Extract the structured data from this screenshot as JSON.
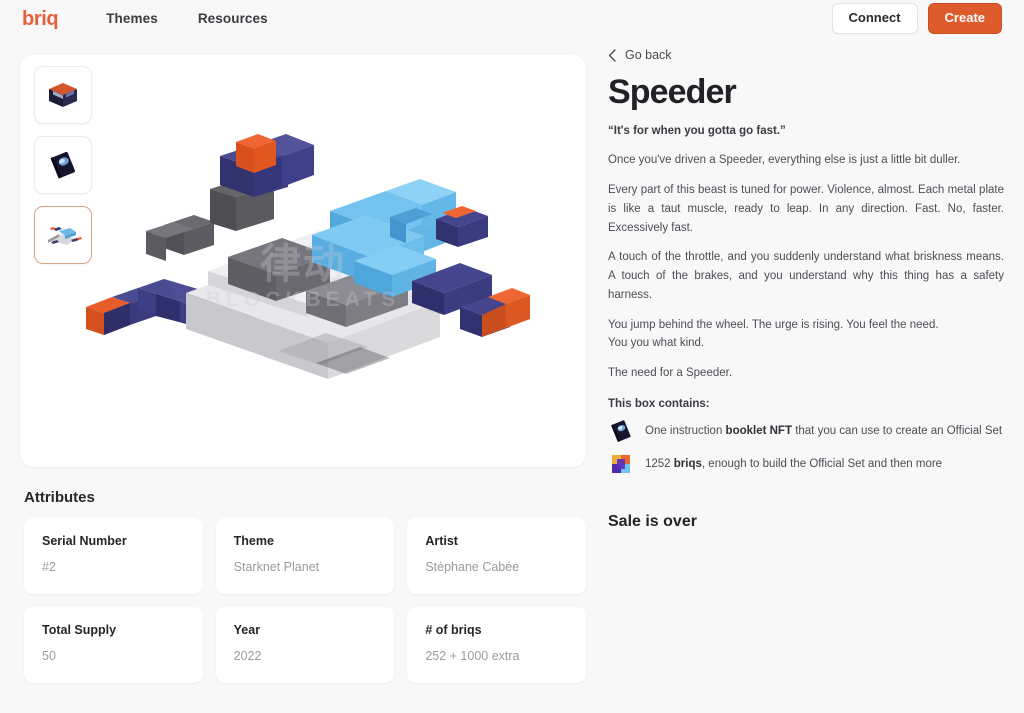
{
  "header": {
    "logo": "briq",
    "nav": [
      {
        "label": "Themes",
        "name": "nav-link-themes"
      },
      {
        "label": "Resources",
        "name": "nav-link-resources"
      }
    ],
    "connect_label": "Connect",
    "create_label": "Create",
    "accent_color": "#de5b2b",
    "logo_color": "#e2613c"
  },
  "viewer": {
    "thumbnails": [
      {
        "alt": "box-package-thumbnail",
        "selected": false
      },
      {
        "alt": "booklet-thumbnail",
        "selected": false
      },
      {
        "alt": "speeder-model-thumbnail",
        "selected": true
      }
    ],
    "model_alt": "speeder-voxel-model",
    "watermark_cn": "律动",
    "watermark_en": "BLOCKBEATS"
  },
  "detail": {
    "go_back": "Go back",
    "title": "Speeder",
    "tagline": "“It's for when you gotta go fast.”",
    "paragraphs": [
      "Once you've driven a Speeder, everything else is just a little bit duller.",
      "Every part of this beast is tuned for power. Violence, almost. Each metal plate is like a taut muscle, ready to leap. In any direction. Fast. No, faster. Excessively fast.",
      "A touch of the throttle, and you suddenly understand what briskness means. A touch of the brakes, and you understand why this thing has a safety harness.",
      "You jump behind the wheel. The urge is rising. You feel the need.\nYou you what kind.",
      "The need for a Speeder."
    ],
    "contains_title": "This box contains:",
    "contains": [
      {
        "icon": "booklet-icon",
        "pre": "One instruction ",
        "strong": "booklet NFT",
        "post": " that you can use to create an Official Set"
      },
      {
        "icon": "briq-cube-icon",
        "pre": "1252 ",
        "strong": "briqs",
        "post": ", enough to build the Official Set and then more"
      }
    ],
    "sale_status": "Sale is over"
  },
  "attributes": {
    "section_title": "Attributes",
    "items": [
      {
        "label": "Serial Number",
        "value": "#2"
      },
      {
        "label": "Theme",
        "value": "Starknet Planet"
      },
      {
        "label": "Artist",
        "value": "Stéphane Cabée"
      },
      {
        "label": "Total Supply",
        "value": "50"
      },
      {
        "label": "Year",
        "value": "2022"
      },
      {
        "label": "# of briqs",
        "value": "252 + 1000 extra"
      }
    ]
  }
}
